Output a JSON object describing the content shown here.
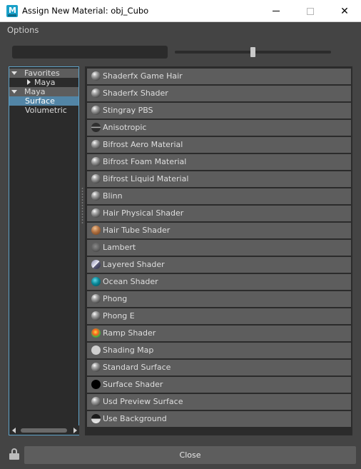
{
  "window": {
    "title": "Assign New Material: obj_Cubo",
    "app_icon_letter": "M"
  },
  "menu": {
    "options_label": "Options"
  },
  "search": {
    "value": "",
    "placeholder": ""
  },
  "swatch_size_slider": {
    "level_fraction": 0.5
  },
  "tree": {
    "items": [
      {
        "label": "Favorites",
        "state": "expanded",
        "depth": 0
      },
      {
        "label": "Maya",
        "state": "collapsed",
        "depth": 1
      },
      {
        "label": "Maya",
        "state": "expanded",
        "depth": 0
      },
      {
        "label": "Surface",
        "state": "selected",
        "depth": 1
      },
      {
        "label": "Volumetric",
        "state": "normal",
        "depth": 1
      }
    ]
  },
  "materials": [
    {
      "label": "Shaderfx Game Hair",
      "icon": "gray-sphere-icon"
    },
    {
      "label": "Shaderfx Shader",
      "icon": "gray-sphere-icon"
    },
    {
      "label": "Stingray PBS",
      "icon": "gray-sphere-icon"
    },
    {
      "label": "Anisotropic",
      "icon": "anisotropic-sphere-icon"
    },
    {
      "label": "Bifrost Aero Material",
      "icon": "gray-sphere-icon"
    },
    {
      "label": "Bifrost Foam Material",
      "icon": "gray-sphere-icon"
    },
    {
      "label": "Bifrost Liquid Material",
      "icon": "gray-sphere-icon"
    },
    {
      "label": "Blinn",
      "icon": "gray-sphere-icon"
    },
    {
      "label": "Hair Physical Shader",
      "icon": "gray-sphere-icon"
    },
    {
      "label": "Hair Tube Shader",
      "icon": "hair-tube-sphere-icon"
    },
    {
      "label": "Lambert",
      "icon": "lambert-sphere-icon"
    },
    {
      "label": "Layered Shader",
      "icon": "layered-sphere-icon"
    },
    {
      "label": "Ocean Shader",
      "icon": "ocean-sphere-icon"
    },
    {
      "label": "Phong",
      "icon": "gray-sphere-icon"
    },
    {
      "label": "Phong E",
      "icon": "gray-sphere-icon"
    },
    {
      "label": "Ramp Shader",
      "icon": "ramp-sphere-icon"
    },
    {
      "label": "Shading Map",
      "icon": "shading-map-sphere-icon"
    },
    {
      "label": "Standard Surface",
      "icon": "gray-sphere-icon"
    },
    {
      "label": "Surface Shader",
      "icon": "black-sphere-icon"
    },
    {
      "label": "Usd Preview Surface",
      "icon": "gray-sphere-icon"
    },
    {
      "label": "Use Background",
      "icon": "background-sphere-icon"
    }
  ],
  "footer": {
    "close_label": "Close",
    "lock_icon": "lock-icon"
  },
  "colors": {
    "background": "#444444",
    "panel": "#2b2b2b",
    "row": "#5d5d5d",
    "selection": "#5285a6",
    "focus_border": "#5fa2c8"
  }
}
